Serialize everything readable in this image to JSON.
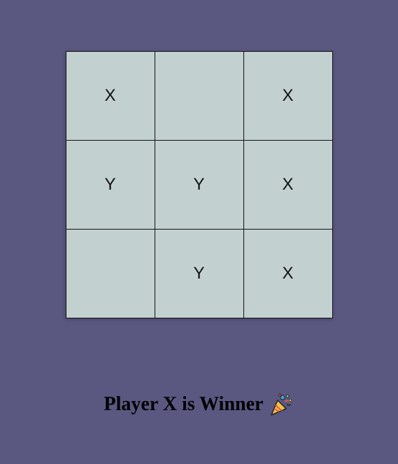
{
  "board": {
    "cells": [
      "X",
      "",
      "X",
      "Y",
      "Y",
      "X",
      "",
      "Y",
      "X"
    ]
  },
  "status": {
    "message": "Player X is Winner",
    "icon": "party-popper-icon"
  },
  "colors": {
    "background": "#5a5781",
    "cell": "#c2d0cf"
  }
}
